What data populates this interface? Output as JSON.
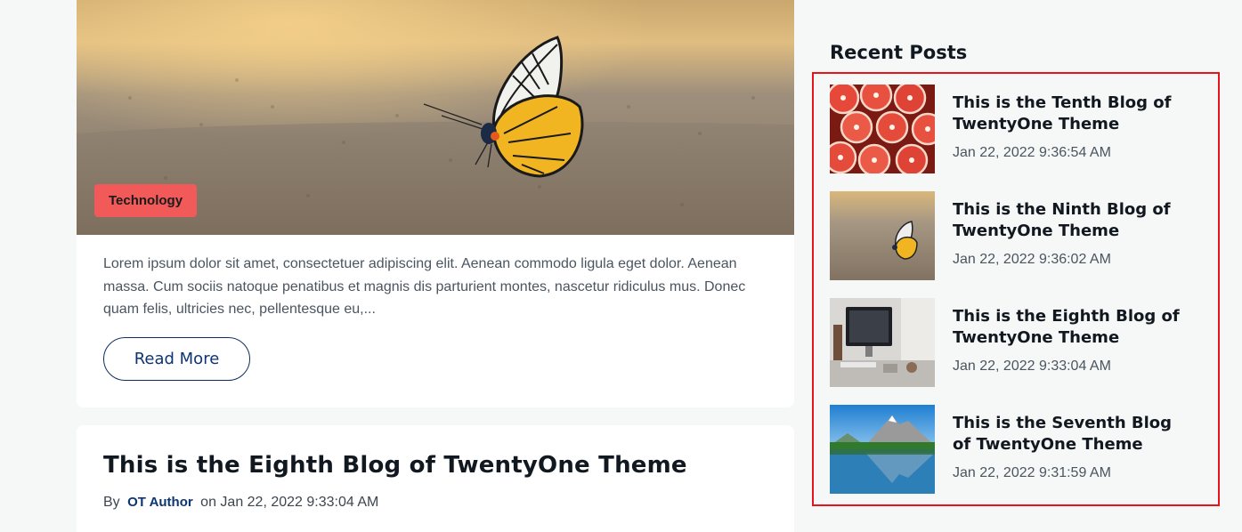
{
  "featured_post": {
    "category": "Technology",
    "excerpt": "Lorem ipsum dolor sit amet, consectetuer adipiscing elit. Aenean commodo ligula eget dolor. Aenean massa. Cum sociis natoque penatibus et magnis dis parturient montes, nascetur ridiculus mus. Donec quam felis, ultricies nec, pellentesque eu,...",
    "read_more_label": "Read More"
  },
  "next_post": {
    "title": "This is the Eighth Blog of TwentyOne Theme",
    "by_label": "By",
    "author": "OT Author",
    "date_text": "on Jan 22, 2022 9:33:04 AM"
  },
  "sidebar": {
    "recent_posts_title": "Recent Posts",
    "posts": [
      {
        "title": "This is the Tenth Blog of TwentyOne Theme",
        "date": "Jan 22, 2022 9:36:54 AM",
        "thumb": "grapefruit-image"
      },
      {
        "title": "This is the Ninth Blog of TwentyOne Theme",
        "date": "Jan 22, 2022 9:36:02 AM",
        "thumb": "butterfly-image"
      },
      {
        "title": "This is the Eighth Blog of TwentyOne Theme",
        "date": "Jan 22, 2022 9:33:04 AM",
        "thumb": "desk-image"
      },
      {
        "title": "This is the Seventh Blog of TwentyOne Theme",
        "date": "Jan 22, 2022 9:31:59 AM",
        "thumb": "mountain-lake-image"
      }
    ]
  },
  "colors": {
    "accent_blue": "#0d3573",
    "badge_red": "#f25a5a",
    "highlight_border": "#e8131b",
    "page_bg": "#f6f8f7"
  }
}
